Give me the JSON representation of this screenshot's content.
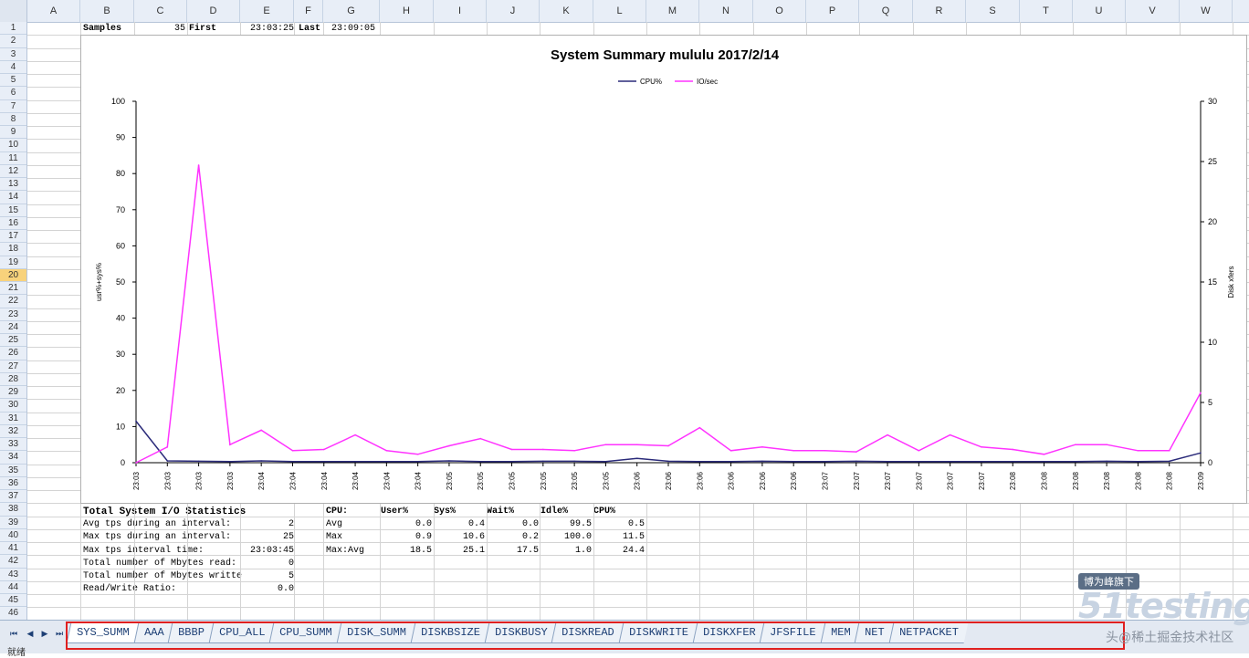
{
  "columns": [
    "A",
    "B",
    "C",
    "D",
    "E",
    "F",
    "G",
    "H",
    "I",
    "J",
    "K",
    "L",
    "M",
    "N",
    "O",
    "P",
    "Q",
    "R",
    "S",
    "T",
    "U",
    "V",
    "W"
  ],
  "rows": [
    "1",
    "2",
    "3",
    "4",
    "5",
    "6",
    "7",
    "8",
    "9",
    "10",
    "11",
    "12",
    "13",
    "14",
    "15",
    "16",
    "17",
    "18",
    "19",
    "20",
    "21",
    "22",
    "23",
    "24",
    "25",
    "26",
    "27",
    "28",
    "29",
    "30",
    "31",
    "32",
    "33",
    "34",
    "35",
    "36",
    "37",
    "38",
    "39",
    "40",
    "41",
    "42",
    "43",
    "44",
    "45",
    "46"
  ],
  "selected_row": "20",
  "row1": {
    "samples_label": "Samples",
    "samples_value": "35",
    "first_label": "First",
    "first_value": "23:03:25",
    "last_label": "Last",
    "last_value": "23:09:05"
  },
  "chart_data": {
    "type": "line",
    "title": "System Summary mululu  2017/2/14",
    "ylabel": "usr%+sys%",
    "y2label": "Disk xfers",
    "ylim": [
      0,
      100
    ],
    "y2lim": [
      0,
      30
    ],
    "yticks": [
      "0",
      "10",
      "20",
      "30",
      "40",
      "50",
      "60",
      "70",
      "80",
      "90",
      "100"
    ],
    "y2ticks": [
      "0",
      "5",
      "10",
      "15",
      "20",
      "25",
      "30"
    ],
    "legend_position": "top",
    "categories": [
      "23:03",
      "23:03",
      "23:03",
      "23:03",
      "23:04",
      "23:04",
      "23:04",
      "23:04",
      "23:04",
      "23:04",
      "23:05",
      "23:05",
      "23:05",
      "23:05",
      "23:05",
      "23:05",
      "23:06",
      "23:06",
      "23:06",
      "23:06",
      "23:06",
      "23:06",
      "23:07",
      "23:07",
      "23:07",
      "23:07",
      "23:07",
      "23:07",
      "23:08",
      "23:08",
      "23:08",
      "23:08",
      "23:08",
      "23:08",
      "23:09"
    ],
    "series": [
      {
        "name": "CPU%",
        "axis": "left",
        "color": "#2b2b7a",
        "values": [
          11.5,
          0.5,
          0.4,
          0.3,
          0.5,
          0.3,
          0.3,
          0.3,
          0.3,
          0.3,
          0.5,
          0.3,
          0.3,
          0.4,
          0.4,
          0.3,
          1.2,
          0.4,
          0.3,
          0.3,
          0.4,
          0.3,
          0.3,
          0.4,
          0.3,
          0.3,
          0.3,
          0.3,
          0.3,
          0.3,
          0.3,
          0.4,
          0.3,
          0.4,
          2.7
        ]
      },
      {
        "name": "IO/sec",
        "axis": "right",
        "color": "#ff33ff",
        "values": [
          0.0,
          1.3,
          24.7,
          1.5,
          2.7,
          1.0,
          1.1,
          2.3,
          1.0,
          0.7,
          1.4,
          2.0,
          1.1,
          1.1,
          1.0,
          1.5,
          1.5,
          1.4,
          2.9,
          1.0,
          1.3,
          1.0,
          1.0,
          0.9,
          2.3,
          1.0,
          2.3,
          1.3,
          1.1,
          0.7,
          1.5,
          1.5,
          1.0,
          1.0,
          5.8
        ]
      }
    ]
  },
  "io_stats": {
    "title": "Total System I/O Statistics",
    "rows": [
      {
        "label": "Avg tps during an interval:",
        "value": "2"
      },
      {
        "label": "Max tps during an interval:",
        "value": "25"
      },
      {
        "label": "Max tps interval time:",
        "value": "23:03:45"
      },
      {
        "label": "Total number of Mbytes read:",
        "value": "0"
      },
      {
        "label": "Total number of Mbytes writte",
        "value": "5"
      },
      {
        "label": "Read/Write Ratio:",
        "value": "0.0"
      }
    ]
  },
  "cpu_stats": {
    "headers": [
      "CPU:",
      "User%",
      "Sys%",
      "Wait%",
      "Idle%",
      "CPU%"
    ],
    "rows": [
      [
        "Avg",
        "0.0",
        "0.4",
        "0.0",
        "99.5",
        "0.5"
      ],
      [
        "Max",
        "0.9",
        "10.6",
        "0.2",
        "100.0",
        "11.5"
      ],
      [
        "Max:Avg",
        "18.5",
        "25.1",
        "17.5",
        "1.0",
        "24.4"
      ]
    ]
  },
  "tabs": [
    "SYS_SUMM",
    "AAA",
    "BBBP",
    "CPU_ALL",
    "CPU_SUMM",
    "DISK_SUMM",
    "DISKBSIZE",
    "DISKBUSY",
    "DISKREAD",
    "DISKWRITE",
    "DISKXFER",
    "JFSFILE",
    "MEM",
    "NET",
    "NETPACKET"
  ],
  "active_tab": "SYS_SUMM",
  "status_text": "就绪",
  "watermark": {
    "badge": "博为峰旗下",
    "logo": "51testing",
    "sub": "头@稀土掘金技术社区"
  },
  "colors": {
    "cpu": "#2b2b7a",
    "io": "#ff33ff",
    "highlight": "#e02020"
  }
}
